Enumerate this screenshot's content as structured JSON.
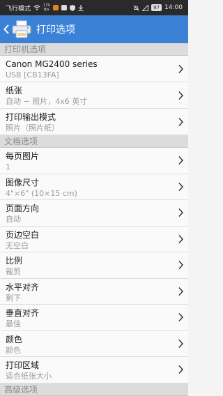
{
  "status_bar": {
    "left_text": "飞行模式",
    "net_speed_top": "179",
    "net_speed_bottom": "B/s",
    "battery": "97",
    "time": "14:00"
  },
  "header": {
    "title": "打印选项",
    "accent": "#3b82d6"
  },
  "sections": [
    {
      "title": "打印机选项",
      "rows": [
        {
          "label": "Canon MG2400 series",
          "value": "USB [CB13FA]"
        },
        {
          "label": "纸张",
          "value": "自动 − 照片，4x6 英寸"
        },
        {
          "label": "打印输出模式",
          "value": "照片（照片纸）"
        }
      ]
    },
    {
      "title": "文档选项",
      "rows": [
        {
          "label": "每页图片",
          "value": "1"
        },
        {
          "label": "图像尺寸",
          "value": "4\"×6\" (10×15 cm)"
        },
        {
          "label": "页面方向",
          "value": "自动"
        },
        {
          "label": "页边空白",
          "value": "无空白"
        },
        {
          "label": "比例",
          "value": "裁剪"
        },
        {
          "label": "水平对齐",
          "value": "剩下"
        },
        {
          "label": "垂直对齐",
          "value": "最佳"
        },
        {
          "label": "颜色",
          "value": "颜色"
        },
        {
          "label": "打印区域",
          "value": "适合纸张大小"
        }
      ]
    },
    {
      "title": "高级选项",
      "rows": []
    }
  ]
}
